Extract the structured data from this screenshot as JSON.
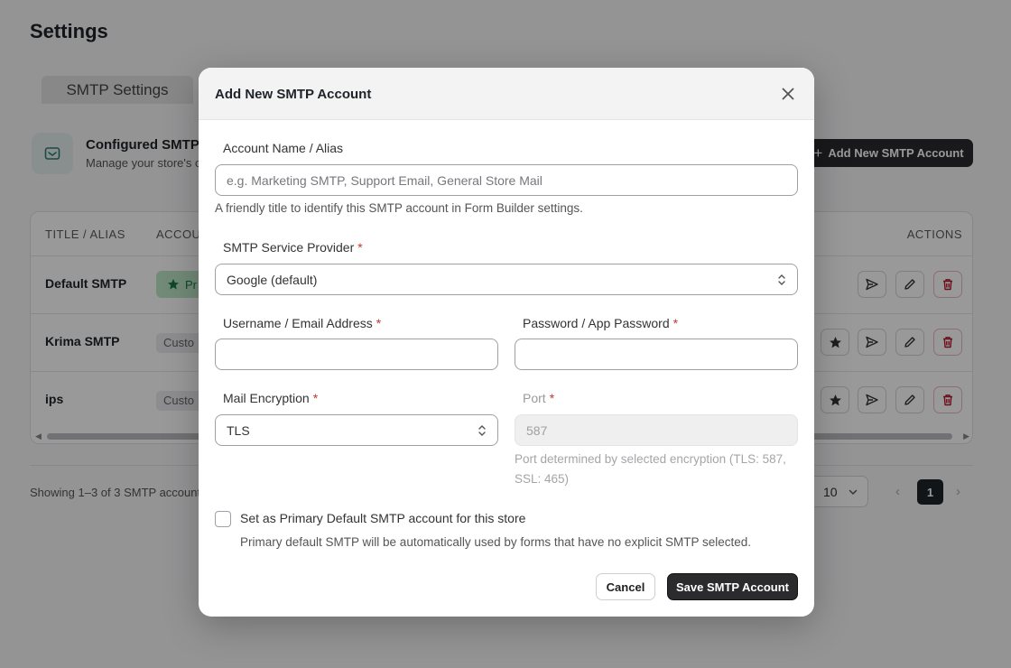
{
  "page": {
    "title": "Settings",
    "tab_label": "SMTP Settings",
    "section_title": "Configured SMTP",
    "section_subtitle": "Manage your store's c",
    "add_button_label": "Add New SMTP Account",
    "table": {
      "columns": [
        "TITLE / ALIAS",
        "ACCOU",
        "ACTIONS"
      ],
      "rows": [
        {
          "title": "Default SMTP",
          "account_badge": "Pr",
          "is_primary": true
        },
        {
          "title": "Krima SMTP",
          "account_badge": "Custo",
          "is_primary": false
        },
        {
          "title": "ips",
          "account_badge": "Custo",
          "is_primary": false
        }
      ]
    },
    "showing_text": "Showing 1–3 of 3 SMTP account",
    "per_page": "10",
    "current_page": "1"
  },
  "modal": {
    "title": "Add New SMTP Account",
    "account_name": {
      "label": "Account Name / Alias",
      "placeholder": "e.g. Marketing SMTP, Support Email, General Store Mail",
      "value": "",
      "help": "A friendly title to identify this SMTP account in Form Builder settings."
    },
    "provider": {
      "label": "SMTP Service Provider",
      "required_mark": "*",
      "value": "Google (default)"
    },
    "username": {
      "label": "Username / Email Address",
      "required_mark": "*",
      "value": ""
    },
    "password": {
      "label": "Password / App Password",
      "required_mark": "*",
      "value": ""
    },
    "encryption": {
      "label": "Mail Encryption",
      "required_mark": "*",
      "value": "TLS"
    },
    "port": {
      "label": "Port",
      "required_mark": "*",
      "value": "587",
      "help": "Port determined by selected encryption (TLS: 587, SSL: 465)"
    },
    "primary_default": {
      "checked": false,
      "label": "Set as Primary Default SMTP account for this store",
      "help": "Primary default SMTP will be automatically used by forms that have no explicit SMTP selected."
    },
    "cancel_label": "Cancel",
    "save_label": "Save SMTP Account"
  },
  "colors": {
    "primary_button": "#2b2b2d",
    "required_asterisk": "#c0392b",
    "delete_icon": "#b4162a",
    "primary_badge": "#bfe6c9",
    "overlay": "rgba(0,0,0,0.40)"
  },
  "icons": [
    "mail-icon",
    "plus-icon",
    "star-icon",
    "send-icon",
    "pencil-icon",
    "trash-icon",
    "close-icon",
    "select-chevrons-icon",
    "chevron-down-icon",
    "chevron-left-icon",
    "chevron-right-icon"
  ]
}
